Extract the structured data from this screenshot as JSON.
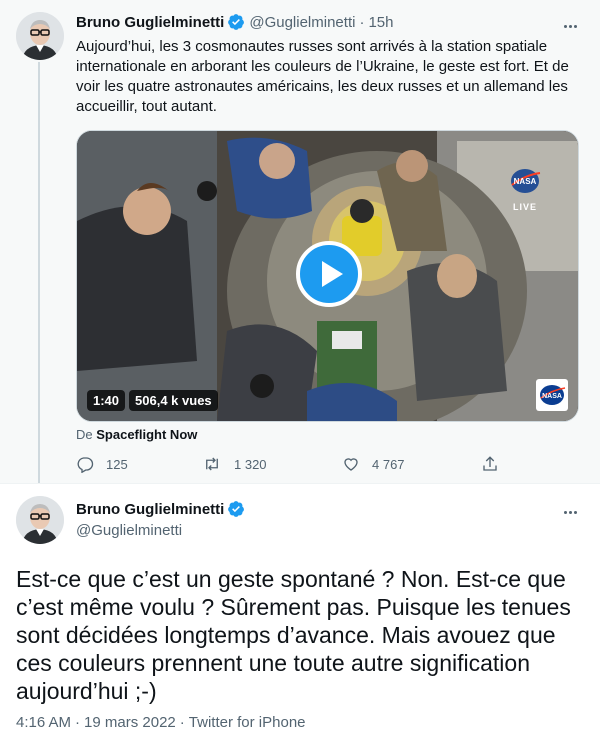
{
  "top_tweet": {
    "author_name": "Bruno Guglielminetti",
    "handle": "@Guglielminetti",
    "separator": "·",
    "time": "15h",
    "text": "Aujourd’hui, les 3 cosmonautes russes sont arrivés à la station spatiale internationale en arborant les couleurs de l’Ukraine, le geste est fort. Et de voir les quatre astronautes américains, les deux russes et un allemand les accueillir, tout autant.",
    "video": {
      "duration": "1:40",
      "views": "506,4 k vues",
      "watermark": "NASA",
      "live_label": "LIVE"
    },
    "caption_prefix": "De",
    "caption_source": "Spaceflight Now",
    "actions": {
      "replies": "125",
      "retweets": "1 320",
      "likes": "4 767"
    }
  },
  "main_tweet": {
    "author_name": "Bruno Guglielminetti",
    "handle": "@Guglielminetti",
    "text": "Est-ce que c’est un geste spontané ? Non. Est-ce que c’est même voulu ? Sûrement pas. Puisque les tenues sont décidées longtemps d’avance. Mais avouez que ces couleurs prennent une toute autre signification aujourd’hui ;-)",
    "time": "4:16 AM",
    "date": "19 mars 2022",
    "source": "Twitter for iPhone",
    "separator": "·"
  },
  "colors": {
    "accent": "#1d9bf0",
    "secondary_text": "#536471",
    "primary_text": "#0f1419",
    "thread_bg": "#f7f9f9"
  }
}
